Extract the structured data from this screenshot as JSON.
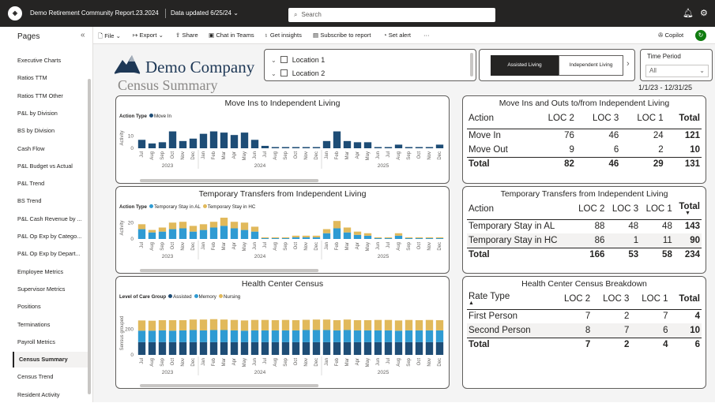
{
  "topbar": {
    "app_icon": "powerbi-org-logo",
    "report_name": "Demo Retirement Community Report.23.2024",
    "data_updated": "Data updated 6/25/24",
    "search_placeholder": "Search",
    "notification_icon": "bell-icon",
    "settings_icon": "gear-icon"
  },
  "sidebar": {
    "title": "Pages",
    "collapse_icon": "chevron-double-left-icon",
    "items": [
      {
        "label": "Executive Charts",
        "active": false
      },
      {
        "label": "Ratios TTM",
        "active": false
      },
      {
        "label": "Ratios TTM Other",
        "active": false
      },
      {
        "label": "P&L by Division",
        "active": false
      },
      {
        "label": "BS by Division",
        "active": false
      },
      {
        "label": "Cash Flow",
        "active": false
      },
      {
        "label": "P&L Budget vs Actual",
        "active": false
      },
      {
        "label": "P&L Trend",
        "active": false
      },
      {
        "label": "BS Trend",
        "active": false
      },
      {
        "label": "P&L Cash Revenue by ...",
        "active": false
      },
      {
        "label": "P&L Op Exp by Catego...",
        "active": false
      },
      {
        "label": "P&L Op Exp by Depart...",
        "active": false
      },
      {
        "label": "Employee Metrics",
        "active": false
      },
      {
        "label": "Supervisor Metrics",
        "active": false
      },
      {
        "label": "Positions",
        "active": false
      },
      {
        "label": "Terminations",
        "active": false
      },
      {
        "label": "Payroll Metrics",
        "active": false
      },
      {
        "label": "Census Summary",
        "active": true
      },
      {
        "label": "Census Trend",
        "active": false
      },
      {
        "label": "Resident Activity",
        "active": false
      }
    ]
  },
  "toolbar": {
    "file": "File",
    "export": "Export",
    "share": "Share",
    "chat": "Chat in Teams",
    "insights": "Get insights",
    "subscribe": "Subscribe to report",
    "alert": "Set alert",
    "more": "···",
    "copilot": "Copilot"
  },
  "header": {
    "company_name": "Demo Company",
    "report_title": "Census Summary",
    "locations": [
      "Location 1",
      "Location 2"
    ],
    "toggle_active": "Assisted Living",
    "toggle_inactive": "Independent Living",
    "time_period_label": "Time Period",
    "time_period_value": "All",
    "date_range": "1/1/23 - 12/31/25"
  },
  "colors": {
    "move_in": "#1e4d76",
    "assisted": "#1e4d76",
    "stay_al": "#2f9bd3",
    "memory": "#2f9bd3",
    "stay_hc": "#e1b95b",
    "nursing": "#e1b95b"
  },
  "chart_data": [
    {
      "type": "bar",
      "title": "Move Ins to Independent Living",
      "legend_title": "Action Type",
      "ylabel": "Activity",
      "yticks": [
        "10",
        "0"
      ],
      "ylim": [
        0,
        17
      ],
      "months": [
        "Jul",
        "Aug",
        "Sep",
        "Oct",
        "Nov",
        "Dec",
        "Jan",
        "Feb",
        "Mar",
        "Apr",
        "May",
        "Jun",
        "Jul",
        "Aug",
        "Sep",
        "Oct",
        "Nov",
        "Dec",
        "Jan",
        "Feb",
        "Mar",
        "Apr",
        "May",
        "Jun",
        "Jul",
        "Aug",
        "Sep",
        "Oct",
        "Nov",
        "Dec"
      ],
      "years": [
        "2023",
        "2024",
        "2025"
      ],
      "series": [
        {
          "name": "Move In",
          "values": [
            7,
            4,
            5,
            14,
            6,
            8,
            12,
            14,
            13,
            11,
            13,
            7,
            2,
            1,
            1,
            1,
            1,
            1,
            6,
            14,
            6,
            5,
            5,
            1,
            1,
            3,
            1,
            1,
            1,
            3
          ]
        }
      ]
    },
    {
      "type": "bar",
      "title": "Temporary Transfers from Independent Living",
      "legend_title": "Action Type",
      "ylabel": "Activity",
      "yticks": [
        "20",
        "0"
      ],
      "ylim": [
        0,
        27
      ],
      "months": [
        "Jul",
        "Aug",
        "Sep",
        "Oct",
        "Nov",
        "Dec",
        "Jan",
        "Feb",
        "Mar",
        "Apr",
        "May",
        "Jun",
        "Jul",
        "Aug",
        "Sep",
        "Oct",
        "Nov",
        "Dec",
        "Jan",
        "Feb",
        "Mar",
        "Apr",
        "May",
        "Jun",
        "Jul",
        "Aug",
        "Sep",
        "Oct",
        "Nov",
        "Dec"
      ],
      "years": [
        "2023",
        "2024",
        "2025"
      ],
      "series": [
        {
          "name": "Temporary Stay in AL",
          "values": [
            12,
            8,
            9,
            12,
            13,
            9,
            11,
            14,
            16,
            13,
            11,
            9,
            1,
            1,
            1,
            2,
            2,
            2,
            7,
            13,
            8,
            5,
            4,
            1,
            1,
            4,
            1,
            1,
            1,
            1
          ]
        },
        {
          "name": "Temporary Stay in HC",
          "values": [
            6,
            3,
            5,
            8,
            8,
            7,
            7,
            7,
            10,
            8,
            9,
            6,
            1,
            1,
            1,
            2,
            2,
            2,
            5,
            9,
            6,
            4,
            3,
            1,
            1,
            3,
            1,
            1,
            1,
            1
          ]
        }
      ]
    },
    {
      "type": "bar",
      "title": "Health Center Census",
      "legend_title": "Level of Care Group",
      "ylabel": "Sensus grouped",
      "yticks": [
        "200",
        "0"
      ],
      "ylim": [
        0,
        340
      ],
      "months": [
        "Jul",
        "Aug",
        "Sep",
        "Oct",
        "Nov",
        "Dec",
        "Jan",
        "Feb",
        "Mar",
        "Apr",
        "May",
        "Jun",
        "Jul",
        "Aug",
        "Sep",
        "Oct",
        "Nov",
        "Dec",
        "Jan",
        "Feb",
        "Mar",
        "Apr",
        "May",
        "Jun",
        "Jul",
        "Aug",
        "Sep",
        "Oct",
        "Nov",
        "Dec"
      ],
      "years": [
        "2023",
        "2024",
        "2025"
      ],
      "series": [
        {
          "name": "Assisted",
          "values": [
            100,
            100,
            100,
            100,
            100,
            100,
            100,
            100,
            100,
            100,
            100,
            100,
            100,
            100,
            100,
            100,
            100,
            100,
            100,
            100,
            100,
            100,
            100,
            100,
            100,
            100,
            100,
            100,
            100,
            100
          ]
        },
        {
          "name": "Memory",
          "values": [
            90,
            90,
            92,
            90,
            92,
            95,
            92,
            95,
            95,
            92,
            90,
            92,
            92,
            92,
            92,
            92,
            95,
            95,
            95,
            92,
            95,
            92,
            92,
            92,
            92,
            90,
            92,
            92,
            92,
            92
          ]
        },
        {
          "name": "Nursing",
          "values": [
            80,
            78,
            80,
            82,
            80,
            82,
            85,
            85,
            82,
            82,
            80,
            82,
            82,
            80,
            82,
            80,
            80,
            82,
            82,
            80,
            82,
            80,
            80,
            82,
            82,
            80,
            82,
            80,
            82,
            80
          ]
        }
      ]
    }
  ],
  "tables": {
    "move_ins_outs": {
      "title": "Move Ins and Outs to/from Independent Living",
      "columns": [
        "Action",
        "LOC 2",
        "LOC 3",
        "LOC 1",
        "Total"
      ],
      "rows": [
        [
          "Move In",
          "76",
          "46",
          "24",
          "121"
        ],
        [
          "Move Out",
          "9",
          "6",
          "2",
          "10"
        ]
      ],
      "total": [
        "Total",
        "82",
        "46",
        "29",
        "131"
      ]
    },
    "transfers": {
      "title": "Temporary Transfers from Independent Living",
      "columns": [
        "Action",
        "LOC 2",
        "LOC 3",
        "LOC 1",
        "Total"
      ],
      "rows": [
        [
          "Temporary Stay in AL",
          "88",
          "48",
          "48",
          "143"
        ],
        [
          "Temporary Stay in HC",
          "86",
          "1",
          "11",
          "90"
        ]
      ],
      "total": [
        "Total",
        "166",
        "53",
        "58",
        "234"
      ]
    },
    "hc_breakdown": {
      "title": "Health Center Census Breakdown",
      "columns": [
        "Rate Type",
        "LOC 2",
        "LOC 3",
        "LOC 1",
        "Total"
      ],
      "rows": [
        [
          "First Person",
          "7",
          "2",
          "7",
          "4"
        ],
        [
          "Second Person",
          "8",
          "7",
          "6",
          "10"
        ]
      ],
      "total": [
        "Total",
        "7",
        "2",
        "4",
        "6"
      ]
    }
  }
}
